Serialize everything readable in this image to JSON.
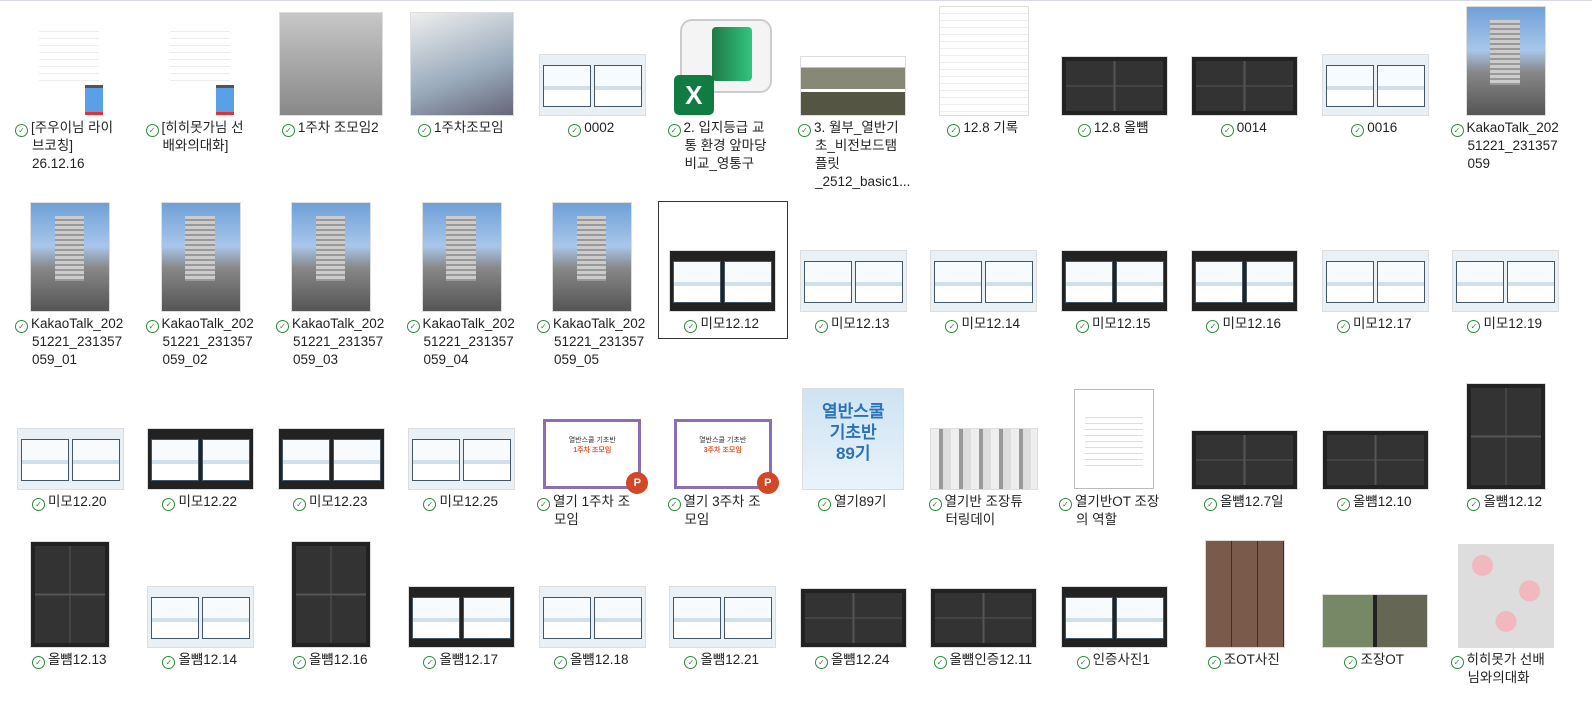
{
  "items": [
    [
      {
        "name": "[주우이님 라이브코칭] 26.12.16",
        "lines": [
          "[주우이님 라이",
          "브코칭]",
          "26.12.16"
        ],
        "kind": "doc"
      },
      {
        "name": "[히히못가님 선배와의대화]",
        "lines": [
          "[히히못가님 선",
          "배와의대화]"
        ],
        "kind": "doc"
      },
      {
        "name": "1주차 조모임2",
        "lines": [
          "1주차 조모임2"
        ],
        "kind": "photo"
      },
      {
        "name": "1주차조모임",
        "lines": [
          "1주차조모임"
        ],
        "kind": "photo p2"
      },
      {
        "name": "0002",
        "lines": [
          "0002"
        ],
        "kind": "slides"
      },
      {
        "name": "2. 입지등급 교통 환경 앞마당 비교_영통구",
        "lines": [
          "2. 입지등급 교",
          "통 환경 앞마당",
          "비교_영통구"
        ],
        "kind": "excel"
      },
      {
        "name": "3. 월부_열반기초_비전보드템플릿_2512_basic1...",
        "lines": [
          "3. 월부_열반기",
          "초_비전보드탬",
          "플릿",
          "_2512_basic1..."
        ],
        "kind": "strip"
      },
      {
        "name": "12.8 기록",
        "lines": [
          "12.8 기록"
        ],
        "kind": "webtab"
      },
      {
        "name": "12.8 올뻄",
        "lines": [
          "12.8 올뻄"
        ],
        "kind": "zoom"
      },
      {
        "name": "0014",
        "lines": [
          "0014"
        ],
        "kind": "zoom"
      },
      {
        "name": "0016",
        "lines": [
          "0016"
        ],
        "kind": "slides"
      },
      {
        "name": "KakaoTalk_20251221_231357059",
        "lines": [
          "KakaoTalk_202",
          "51221_231357",
          "059"
        ],
        "kind": "bld"
      }
    ],
    [
      {
        "name": "KakaoTalk_20251221_231357059_01",
        "lines": [
          "KakaoTalk_202",
          "51221_231357",
          "059_01"
        ],
        "kind": "bld"
      },
      {
        "name": "KakaoTalk_20251221_231357059_02",
        "lines": [
          "KakaoTalk_202",
          "51221_231357",
          "059_02"
        ],
        "kind": "bld"
      },
      {
        "name": "KakaoTalk_20251221_231357059_03",
        "lines": [
          "KakaoTalk_202",
          "51221_231357",
          "059_03"
        ],
        "kind": "bld"
      },
      {
        "name": "KakaoTalk_20251221_231357059_04",
        "lines": [
          "KakaoTalk_202",
          "51221_231357",
          "059_04"
        ],
        "kind": "bld"
      },
      {
        "name": "KakaoTalk_20251221_231357059_05",
        "lines": [
          "KakaoTalk_202",
          "51221_231357",
          "059_05"
        ],
        "kind": "bld"
      },
      {
        "name": "미모12.12",
        "lines": [
          "미모12.12"
        ],
        "kind": "slides dk",
        "selected": true
      },
      {
        "name": "미모12.13",
        "lines": [
          "미모12.13"
        ],
        "kind": "slides"
      },
      {
        "name": "미모12.14",
        "lines": [
          "미모12.14"
        ],
        "kind": "slides"
      },
      {
        "name": "미모12.15",
        "lines": [
          "미모12.15"
        ],
        "kind": "slides dk"
      },
      {
        "name": "미모12.16",
        "lines": [
          "미모12.16"
        ],
        "kind": "slides dk"
      },
      {
        "name": "미모12.17",
        "lines": [
          "미모12.17"
        ],
        "kind": "slides"
      },
      {
        "name": "미모12.19",
        "lines": [
          "미모12.19"
        ],
        "kind": "slides"
      }
    ],
    [
      {
        "name": "미모12.20",
        "lines": [
          "미모12.20"
        ],
        "kind": "slides"
      },
      {
        "name": "미모12.22",
        "lines": [
          "미모12.22"
        ],
        "kind": "slides dk"
      },
      {
        "name": "미모12.23",
        "lines": [
          "미모12.23"
        ],
        "kind": "slides dk"
      },
      {
        "name": "미모12.25",
        "lines": [
          "미모12.25"
        ],
        "kind": "slides"
      },
      {
        "name": "열기 1주차 조모임",
        "lines": [
          "열기 1주차 조",
          "모임"
        ],
        "kind": "ppt",
        "ppt_title": "열반스쿨 기초반",
        "ppt_sub": "1주차 조모임"
      },
      {
        "name": "열기 3주차 조모임",
        "lines": [
          "열기 3주차 조",
          "모임"
        ],
        "kind": "ppt",
        "ppt_title": "열반스쿨 기초반",
        "ppt_sub": "3주차 조모임"
      },
      {
        "name": "열기89기",
        "lines": [
          "열기89기"
        ],
        "kind": "poster",
        "poster_text": [
          "열반스쿨",
          "기초반",
          "89기"
        ]
      },
      {
        "name": "열기반 조장튜터링데이",
        "lines": [
          "열기반 조장튜",
          "터링데이"
        ],
        "kind": "mono"
      },
      {
        "name": "열기반OT 조장의 역할",
        "lines": [
          "열기반OT 조장",
          "의 역할"
        ],
        "kind": "file"
      },
      {
        "name": "올뻄12.7일",
        "lines": [
          "올뻄12.7일"
        ],
        "kind": "zoom"
      },
      {
        "name": "올뻄12.10",
        "lines": [
          "올뻄12.10"
        ],
        "kind": "zoom"
      },
      {
        "name": "올뻄12.12",
        "lines": [
          "올뻄12.12"
        ],
        "kind": "zoomsq"
      }
    ],
    [
      {
        "name": "올뻄12.13",
        "lines": [
          "올뻄12.13"
        ],
        "kind": "zoomsq"
      },
      {
        "name": "올뻄12.14",
        "lines": [
          "올뻄12.14"
        ],
        "kind": "slides"
      },
      {
        "name": "올뻄12.16",
        "lines": [
          "올뻄12.16"
        ],
        "kind": "zoomsq"
      },
      {
        "name": "올뻄12.17",
        "lines": [
          "올뻄12.17"
        ],
        "kind": "slides dk"
      },
      {
        "name": "올뻄12.18",
        "lines": [
          "올뻄12.18"
        ],
        "kind": "slides"
      },
      {
        "name": "올뻄12.21",
        "lines": [
          "올뻄12.21"
        ],
        "kind": "slides"
      },
      {
        "name": "올뻄12.24",
        "lines": [
          "올뻄12.24"
        ],
        "kind": "zoom"
      },
      {
        "name": "올뻄인증12.11",
        "lines": [
          "올뻄인증12.11"
        ],
        "kind": "zoom"
      },
      {
        "name": "인증사진1",
        "lines": [
          "인증사진1"
        ],
        "kind": "slides dk"
      },
      {
        "name": "조OT사진",
        "lines": [
          "조OT사진"
        ],
        "kind": "cam"
      },
      {
        "name": "조장OT",
        "lines": [
          "조장OT"
        ],
        "kind": "cam2"
      },
      {
        "name": "히히못가 선배님와의대화",
        "lines": [
          "히히못가 선배",
          "님와의대화"
        ],
        "kind": "pig"
      }
    ]
  ],
  "sync_icon": "check-circle-icon",
  "accent": "#2e8b3a"
}
